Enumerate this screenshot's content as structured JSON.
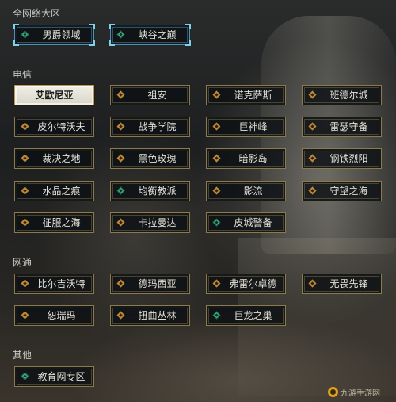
{
  "sections": {
    "all": {
      "title": "全网络大区"
    },
    "telecom": {
      "title": "电信"
    },
    "netcom": {
      "title": "网通"
    },
    "other": {
      "title": "其他"
    }
  },
  "servers": {
    "all": [
      {
        "label": "男爵领域",
        "indicator": "green"
      },
      {
        "label": "峡谷之巅",
        "indicator": "green"
      }
    ],
    "telecom": [
      {
        "label": "艾欧尼亚",
        "selected": true
      },
      {
        "label": "祖安",
        "indicator": "orange"
      },
      {
        "label": "诺克萨斯",
        "indicator": "orange"
      },
      {
        "label": "班德尔城",
        "indicator": "orange"
      },
      {
        "label": "皮尔特沃夫",
        "indicator": "orange"
      },
      {
        "label": "战争学院",
        "indicator": "orange"
      },
      {
        "label": "巨神峰",
        "indicator": "orange"
      },
      {
        "label": "雷瑟守备",
        "indicator": "orange"
      },
      {
        "label": "裁决之地",
        "indicator": "orange"
      },
      {
        "label": "黑色玫瑰",
        "indicator": "orange"
      },
      {
        "label": "暗影岛",
        "indicator": "orange"
      },
      {
        "label": "钢铁烈阳",
        "indicator": "orange"
      },
      {
        "label": "水晶之痕",
        "indicator": "orange"
      },
      {
        "label": "均衡教派",
        "indicator": "green"
      },
      {
        "label": "影流",
        "indicator": "orange"
      },
      {
        "label": "守望之海",
        "indicator": "orange"
      },
      {
        "label": "征服之海",
        "indicator": "orange"
      },
      {
        "label": "卡拉曼达",
        "indicator": "orange"
      },
      {
        "label": "皮城警备",
        "indicator": "green"
      }
    ],
    "netcom": [
      {
        "label": "比尔吉沃特",
        "indicator": "orange"
      },
      {
        "label": "德玛西亚",
        "indicator": "orange"
      },
      {
        "label": "弗雷尔卓德",
        "indicator": "orange"
      },
      {
        "label": "无畏先锋",
        "indicator": "orange"
      },
      {
        "label": "恕瑞玛",
        "indicator": "orange"
      },
      {
        "label": "扭曲丛林",
        "indicator": "orange"
      },
      {
        "label": "巨龙之巢",
        "indicator": "green"
      }
    ],
    "other": [
      {
        "label": "教育网专区",
        "indicator": "green"
      }
    ]
  },
  "watermark": {
    "text": "九游手游网"
  },
  "colors": {
    "border_gold": "#8b7a4e",
    "border_blue": "#4c8fb0",
    "indicator_orange": "#c9852b",
    "indicator_green": "#3fbf8e"
  }
}
